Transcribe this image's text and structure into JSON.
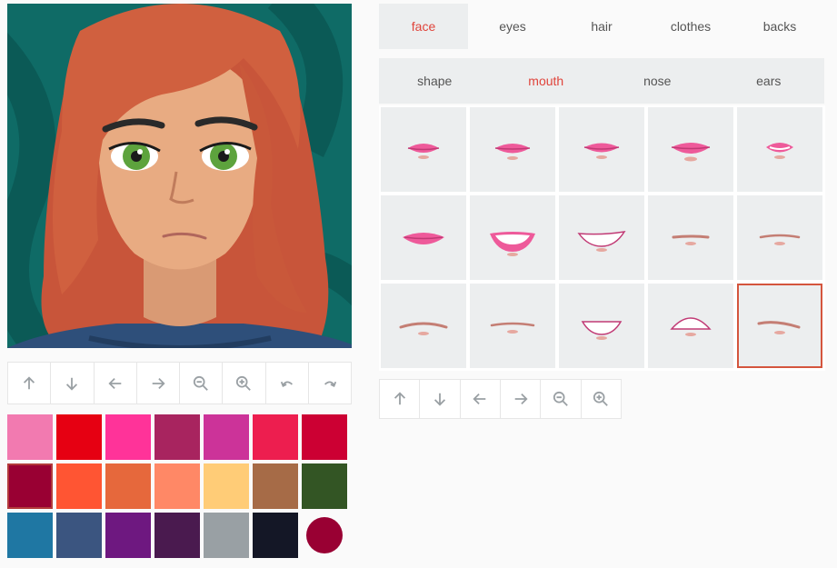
{
  "avatar": {
    "name": "avatar-preview"
  },
  "avatar_toolbar": {
    "buttons": [
      {
        "name": "move-up-button",
        "icon": "arrow-up-icon"
      },
      {
        "name": "move-down-button",
        "icon": "arrow-down-icon"
      },
      {
        "name": "move-left-button",
        "icon": "arrow-left-icon"
      },
      {
        "name": "move-right-button",
        "icon": "arrow-right-icon"
      },
      {
        "name": "zoom-out-button",
        "icon": "zoom-out-icon"
      },
      {
        "name": "zoom-in-button",
        "icon": "zoom-in-icon"
      },
      {
        "name": "undo-button",
        "icon": "undo-icon"
      },
      {
        "name": "redo-button",
        "icon": "redo-icon"
      }
    ]
  },
  "swatches": {
    "colors": [
      "#f27ab0",
      "#e60012",
      "#ff3399",
      "#a8245f",
      "#cc3399",
      "#ed1e4f",
      "#cc0033",
      "#990033",
      "#ff5533",
      "#e6683c",
      "#ff8866",
      "#ffcc77",
      "#a66b47",
      "#335524",
      "#1f77a3",
      "#3b5580",
      "#6e1880",
      "#4a1a4f",
      "#99a0a4",
      "#141726"
    ],
    "selected_index": 7,
    "picker_color": "#990033"
  },
  "category_tabs": [
    {
      "label": "face",
      "active": true
    },
    {
      "label": "eyes",
      "active": false
    },
    {
      "label": "hair",
      "active": false
    },
    {
      "label": "clothes",
      "active": false
    },
    {
      "label": "backs",
      "active": false
    }
  ],
  "sub_tabs": [
    {
      "label": "shape",
      "active": false
    },
    {
      "label": "mouth",
      "active": true
    },
    {
      "label": "nose",
      "active": false
    },
    {
      "label": "ears",
      "active": false
    }
  ],
  "mouth_options": {
    "count": 15,
    "selected_index": 14,
    "colors": {
      "lip": "#ee5a9a",
      "lip_dark": "#c13a75",
      "chin": "#e6a8a0",
      "line": "#c47e74"
    }
  },
  "part_toolbar": {
    "buttons": [
      {
        "name": "part-move-up-button",
        "icon": "arrow-up-icon"
      },
      {
        "name": "part-move-down-button",
        "icon": "arrow-down-icon"
      },
      {
        "name": "part-move-left-button",
        "icon": "arrow-left-icon"
      },
      {
        "name": "part-move-right-button",
        "icon": "arrow-right-icon"
      },
      {
        "name": "part-zoom-out-button",
        "icon": "zoom-out-icon"
      },
      {
        "name": "part-zoom-in-button",
        "icon": "zoom-in-icon"
      }
    ]
  }
}
